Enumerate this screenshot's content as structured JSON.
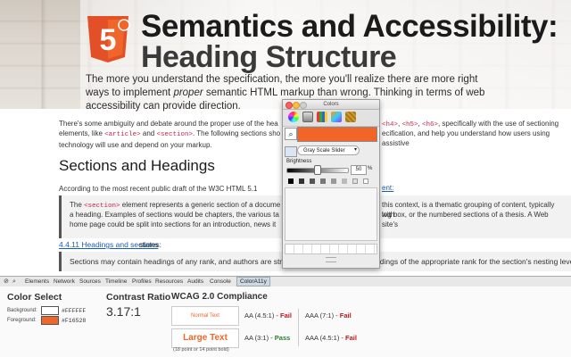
{
  "hero": {
    "title_line1": "Semantics and Accessibility:",
    "title_line2": "Heading Structure",
    "intro_a": "The more you understand the specification, the more you'll realize there are more right ways to implement ",
    "intro_em": "proper",
    "intro_b": " semantic HTML markup than wrong. Thinking in terms of web accessibility can provide direction.",
    "logo_text": "5"
  },
  "article": {
    "p1_left": "There's some ambiguity and debate around the proper use of the hea",
    "p1_left2a": "elements, like ",
    "p1_code1": "<article>",
    "p1_left2b": " and ",
    "p1_code2": "<section>",
    "p1_left2c": ". The following sections sho",
    "p1_left3": "technology will use and depend on your markup.",
    "p1_right_code1": "<h4>",
    "p1_right_code2": "<h5>",
    "p1_right_code3": "<h6>",
    "p1_right_text": ", specifically with the use of sectioning",
    "p1_right2": "ecification, and help you understand how users using assistive",
    "heading": "Sections and Headings",
    "p2": "According to the most recent public draft of the W3C HTML 5.1 specific",
    "p2_link": "ent:",
    "q1_code": "<section>",
    "q1a_rest": " element represents a generic section of a docume",
    "q1b": "a heading. Examples of sections would be chapters, the various ta",
    "q1c": "home page could be split into sections for an introduction, news it",
    "q1d": "this context, is a thematic grouping of content, typically with",
    "q1e": "log box, or the numbered sections of a thesis. A Web site's",
    "q1_the": "The",
    "link2": "4.4.11 Headings and sections",
    "states": "states:",
    "q2": "Sections may contain headings of any rank, and authors are strongly encouraged to use headings of the appropriate rank for the section's nesting level."
  },
  "colors_panel": {
    "title": "Colors",
    "selected_color": "#f16528",
    "mode": "Gray Scale Slider",
    "brightness_label": "Brightness",
    "brightness_value": "50",
    "brightness_unit": "%",
    "brightness_fraction": 0.5
  },
  "devtools": {
    "tabs": [
      "Elements",
      "Network",
      "Sources",
      "Timeline",
      "Profiles",
      "Resources",
      "Audits",
      "Console"
    ],
    "active_tab": "ColorA11y",
    "color_select_title": "Color Select",
    "background_label": "Background:",
    "foreground_label": "Foreground:",
    "background_hex": "#FFFFFF",
    "foreground_hex": "#F16528",
    "background_color": "#ffffff",
    "foreground_color": "#f16528",
    "contrast_title": "Contrast Ratio",
    "contrast_value": "3.17:1",
    "wcag_title": "WCAG 2.0 Compliance",
    "normal_text_label": "Normal Text",
    "large_text_label": "Large Text",
    "large_text_note": "(18 point or 14 point bold)",
    "normal_aa": "AA (4.5:1) - ",
    "normal_aa_result": "Fail",
    "normal_aaa": "AAA (7:1) - ",
    "normal_aaa_result": "Fail",
    "large_aa": "AA (3:1) - ",
    "large_aa_result": "Pass",
    "large_aaa": "AAA (4.5:1) - ",
    "large_aaa_result": "Fail"
  }
}
